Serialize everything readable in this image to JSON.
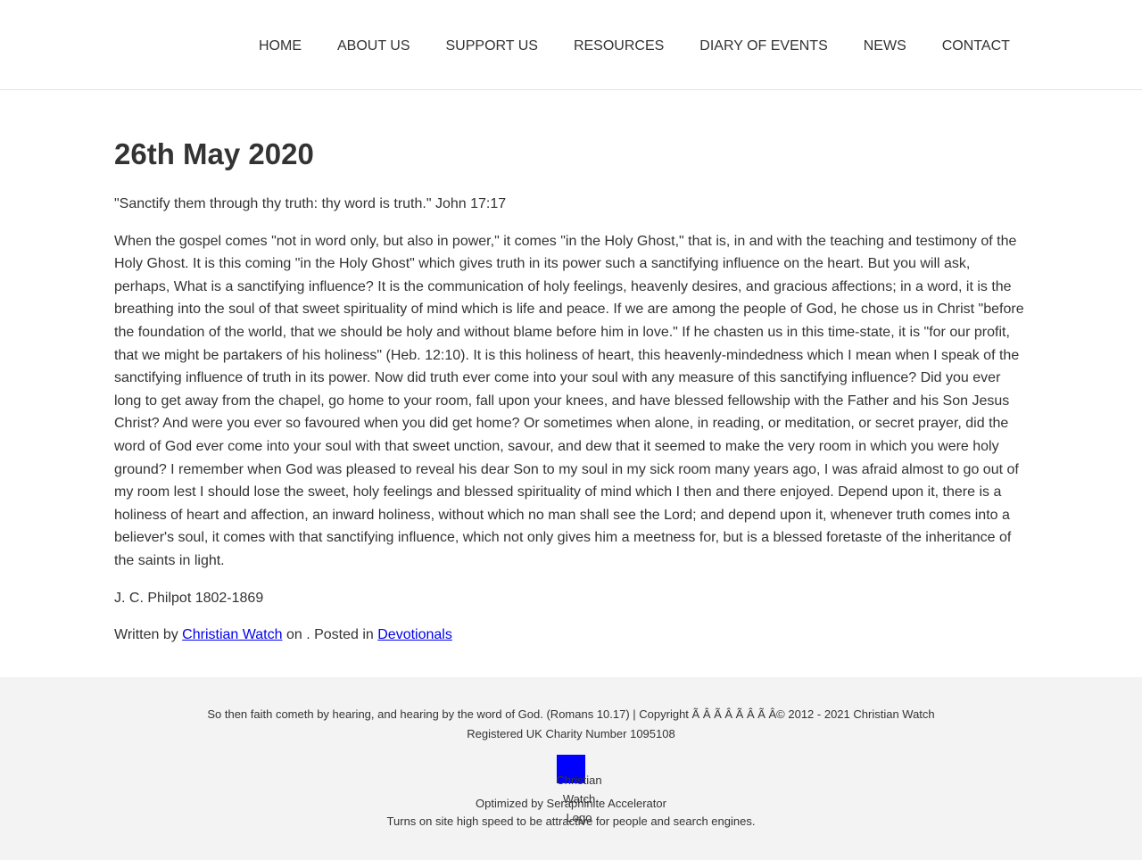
{
  "nav": {
    "items": [
      {
        "label": "HOME"
      },
      {
        "label": "ABOUT US"
      },
      {
        "label": "SUPPORT US"
      },
      {
        "label": "RESOURCES"
      },
      {
        "label": "DIARY OF EVENTS"
      },
      {
        "label": "NEWS"
      },
      {
        "label": "CONTACT"
      }
    ]
  },
  "post": {
    "title": "26th May 2020",
    "verse": "\"Sanctify them through thy truth: thy word is truth.\" John 17:17",
    "body": "When the gospel comes \"not in word only, but also in power,\" it comes \"in the Holy Ghost,\" that is, in and with the teaching and testimony of the Holy Ghost. It is this coming \"in the Holy Ghost\" which gives truth in its power such a sanctifying influence on the heart. But you will ask, perhaps, What is a sanctifying influence? It is the communication of holy feelings, heavenly desires, and gracious affections; in a word, it is the breathing into the soul of that sweet spirituality of mind which is life and peace. If we are among the people of God, he chose us in Christ \"before the foundation of the world, that we should be holy and without blame before him in love.\" If he chasten us in this time-state, it is \"for our profit, that we might be partakers of his holiness\" (Heb. 12:10). It is this holiness of heart, this heavenly-mindedness which I mean when I speak of the sanctifying influence of truth in its power. Now did truth ever come into your soul with any measure of this sanctifying influence? Did you ever long to get away from the chapel, go home to your room, fall upon your knees, and have blessed fellowship with the Father and his Son Jesus Christ? And were you ever so favoured when you did get home? Or sometimes when alone, in reading, or meditation, or secret prayer, did the word of God ever come into your soul with that sweet unction, savour, and dew that it seemed to make the very room in which you were holy ground? I remember when God was pleased to reveal his dear Son to my soul in my sick room many years ago, I was afraid almost to go out of my room lest I should lose the sweet, holy feelings and blessed spirituality of mind which I then and there enjoyed. Depend upon it, there is a holiness of heart and affection, an inward holiness, without which no man shall see the Lord; and depend upon it, whenever truth comes into a believer's soul, it comes with that sanctifying influence, which not only gives him a meetness for, but is a blessed foretaste of the inheritance of the saints in light.",
    "author": "J. C. Philpot 1802-1869",
    "byline": {
      "prefix": "Written by ",
      "author_link": "Christian Watch",
      "middle": " on . Posted in ",
      "category_link": "Devotionals"
    }
  },
  "footer": {
    "line1": "So then faith cometh by hearing, and hearing by the word of God. (Romans 10.17) | Copyright Ã Â Ã Â Ã Â Ã Â© 2012 - 2021 Christian Watch",
    "line2": "Registered UK Charity Number 1095108",
    "logo_alt": "Christian Watch Logo",
    "optimized": "Optimized by Seraphinite Accelerator",
    "tagline": "Turns on site high speed to be attractive for people and search engines."
  },
  "colors": {
    "text": "#333333",
    "link": "#0000ee",
    "footer_bg": "#f3f3f3",
    "logo_placeholder": "#0000ff"
  }
}
